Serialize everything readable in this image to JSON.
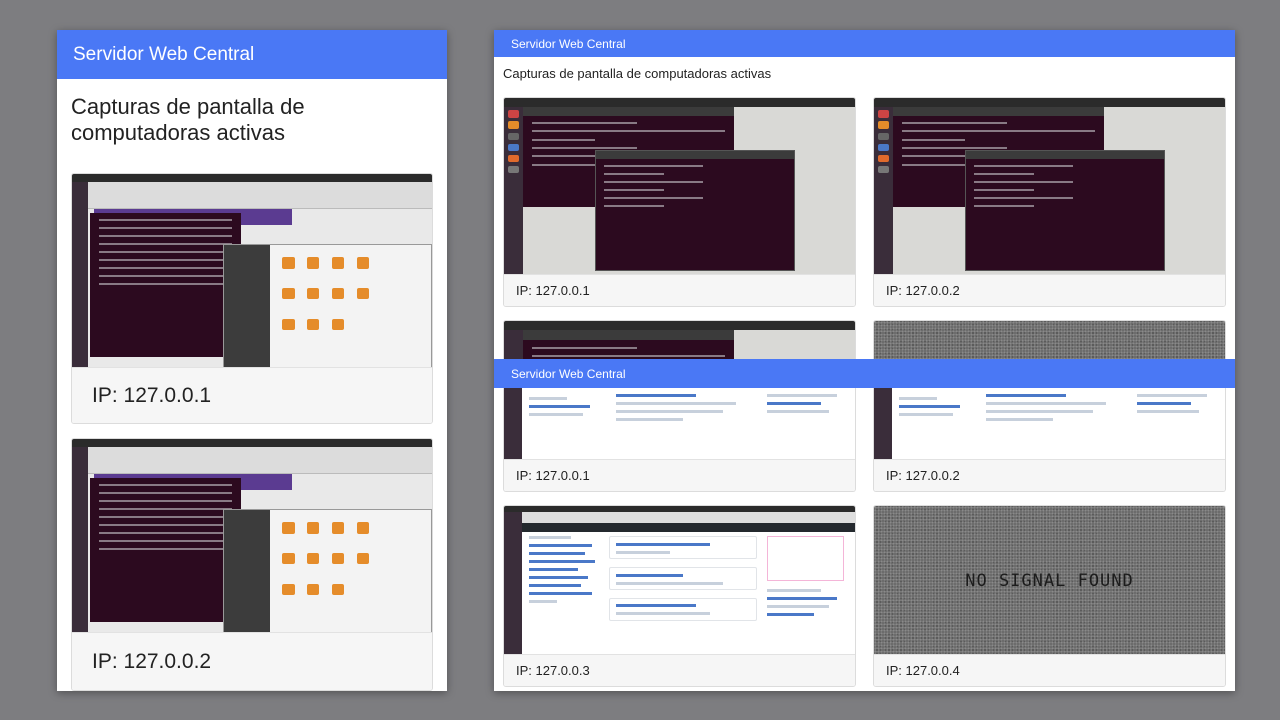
{
  "app": {
    "title": "Servidor Web Central",
    "heading": "Capturas de pantalla de computadoras activas"
  },
  "left_panel": {
    "cards": [
      {
        "ip": "IP: 127.0.0.1",
        "screen": "desktop-terminal-files"
      },
      {
        "ip": "IP: 127.0.0.2",
        "screen": "desktop-terminal-files"
      }
    ]
  },
  "right_panel": {
    "rows_top": [
      {
        "ip": "IP: 127.0.0.1",
        "screen": "ubuntu-terminal"
      },
      {
        "ip": "IP: 127.0.0.2",
        "screen": "ubuntu-terminal"
      }
    ],
    "overlay": {
      "title": "Servidor Web Central",
      "cards": [
        {
          "ip": "IP: 127.0.0.1",
          "screen": "github-page"
        },
        {
          "ip": "IP: 127.0.0.2",
          "screen": "github-page"
        },
        {
          "ip": "IP: 127.0.0.3",
          "screen": "github-page"
        },
        {
          "ip": "IP: 127.0.0.4",
          "screen": "no-signal",
          "no_signal_text": "NO SIGNAL FOUND"
        }
      ]
    }
  },
  "colors": {
    "navbar": "#4a78f5",
    "page_background": "#7d7d80"
  }
}
